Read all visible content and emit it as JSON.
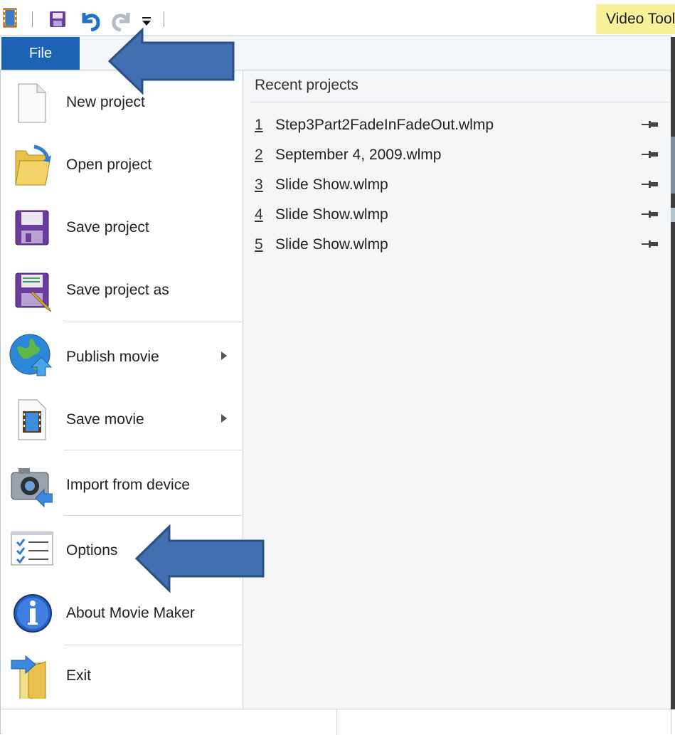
{
  "toolbar": {
    "contextual_tab": "Video Tools",
    "icons": [
      "film-strip-icon",
      "save-icon",
      "undo-icon",
      "redo-icon",
      "customize-dropdown-icon"
    ]
  },
  "ribbon": {
    "file_tab": "File"
  },
  "menu": {
    "items": [
      {
        "label": "New project",
        "icon": "new-project-icon"
      },
      {
        "label": "Open project",
        "icon": "open-folder-icon"
      },
      {
        "label": "Save project",
        "icon": "save-disk-icon"
      },
      {
        "label": "Save project as",
        "icon": "save-as-icon"
      },
      {
        "label": "Publish movie",
        "icon": "globe-upload-icon",
        "submenu": true
      },
      {
        "label": "Save movie",
        "icon": "film-file-icon",
        "submenu": true
      },
      {
        "label": "Import from device",
        "icon": "camera-icon"
      },
      {
        "label": "Options",
        "icon": "checklist-icon"
      },
      {
        "label": "About Movie Maker",
        "icon": "info-icon"
      },
      {
        "label": "Exit",
        "icon": "exit-icon"
      }
    ]
  },
  "recent": {
    "title": "Recent projects",
    "items": [
      {
        "num": "1",
        "name": "Step3Part2FadeInFadeOut.wlmp"
      },
      {
        "num": "2",
        "name": "September 4, 2009.wlmp"
      },
      {
        "num": "3",
        "name": "Slide Show.wlmp"
      },
      {
        "num": "4",
        "name": "Slide Show.wlmp"
      },
      {
        "num": "5",
        "name": "Slide Show.wlmp"
      }
    ]
  },
  "colors": {
    "file_tab": "#1c63b3",
    "callout_arrow": "#3f6fb0",
    "contextual_tab": "#f5f29a"
  }
}
